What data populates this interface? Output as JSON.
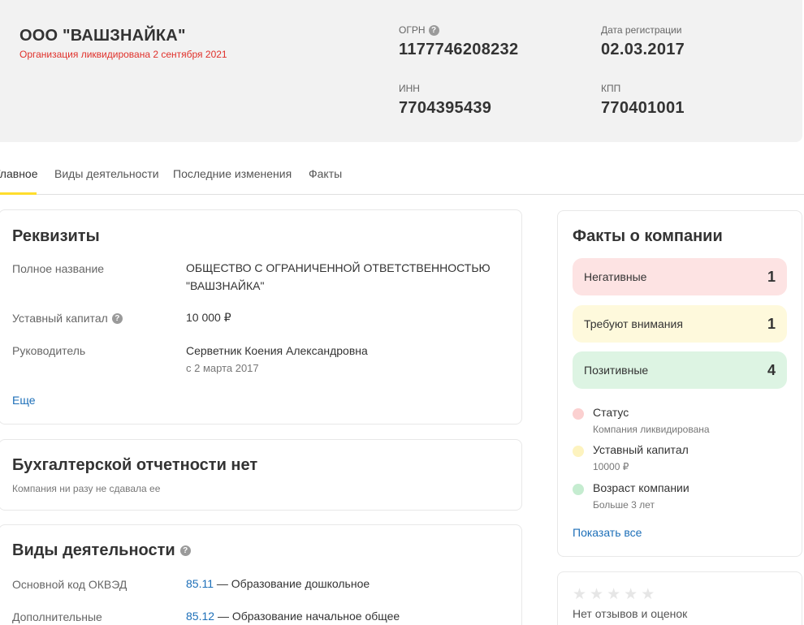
{
  "company": {
    "name": "ООО \"ВАШЗНАЙКА\"",
    "liquidation_note": "Организация ликвидирована 2 сентября 2021"
  },
  "meta": {
    "ogrn_label": "ОГРН",
    "ogrn": "1177746208232",
    "date_label": "Дата регистрации",
    "date": "02.03.2017",
    "inn_label": "ИНН",
    "inn": "7704395439",
    "kpp_label": "КПП",
    "kpp": "770401001"
  },
  "tabs": [
    {
      "label": "Главное",
      "active": true
    },
    {
      "label": "Виды деятельности"
    },
    {
      "label": "Последние изменения"
    },
    {
      "label": "Факты"
    }
  ],
  "requisites": {
    "title": "Реквизиты",
    "full_name_label": "Полное название",
    "full_name_line1": "ОБЩЕСТВО С ОГРАНИЧЕННОЙ ОТВЕТСТВЕННОСТЬЮ",
    "full_name_line2": "\"ВАШЗНАЙКА\"",
    "capital_label": "Уставный капитал",
    "capital": "10 000 ₽",
    "head_label": "Руководитель",
    "head_name": "Серветник Коения Александровна",
    "head_since": "с 2 марта 2017",
    "more_link": "Еще"
  },
  "accounting": {
    "title": "Бухгалтерской отчетности нет",
    "note": "Компания ни разу не сдавала ее"
  },
  "activities": {
    "title": "Виды деятельности",
    "main_label": "Основной код ОКВЭД",
    "main_code": "85.11",
    "main_desc": "— Образование дошкольное",
    "extra_label": "Дополнительные",
    "extra_code": "85.12",
    "extra_desc": "— Образование начальное общее"
  },
  "facts": {
    "title": "Факты о компании",
    "negative_label": "Негативные",
    "negative_count": "1",
    "warning_label": "Требуют внимания",
    "warning_count": "1",
    "positive_label": "Позитивные",
    "positive_count": "4",
    "items": [
      {
        "title": "Статус",
        "subtitle": "Компания ликвидирована",
        "color": "#fbd0d0"
      },
      {
        "title": "Уставный капитал",
        "subtitle": "10000 ₽",
        "color": "#fdf3bf"
      },
      {
        "title": "Возраст компании",
        "subtitle": "Больше 3 лет",
        "color": "#c5ecd0"
      }
    ],
    "show_all": "Показать все"
  },
  "reviews": {
    "rating": 0,
    "max_rating": 5,
    "empty_text": "Нет отзывов и оценок"
  },
  "colors": {
    "accent": "#ffdd2d",
    "link": "#1d6fb8",
    "danger": "#e0302a"
  }
}
